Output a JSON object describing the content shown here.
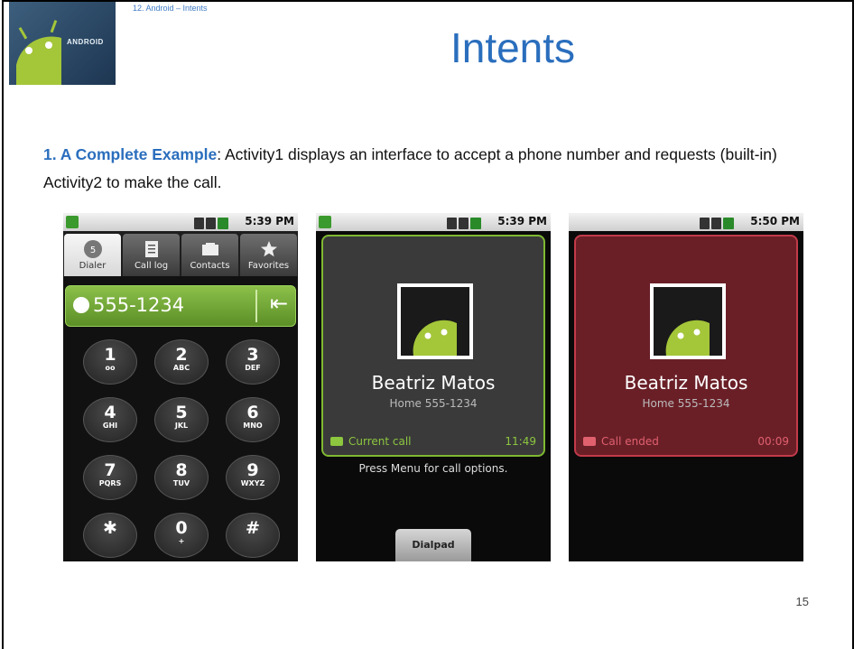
{
  "slide": {
    "breadcrumb": "12. Android – Intents",
    "title": "Intents",
    "logo_text": "ANDROID",
    "intro_lead": "1. A Complete Example",
    "intro_rest": ":  Activity1  displays an interface to accept a phone number and requests (built-in) Activity2 to make the call.",
    "page_number": "15"
  },
  "phone1": {
    "status_time": "5:39 PM",
    "tabs": [
      {
        "label": "Dialer",
        "icon": "dialer-icon"
      },
      {
        "label": "Call log",
        "icon": "call-log-icon"
      },
      {
        "label": "Contacts",
        "icon": "contacts-icon"
      },
      {
        "label": "Favorites",
        "icon": "star-icon"
      }
    ],
    "number": "555-1234",
    "keys": [
      {
        "d": "1",
        "l": "ᴏᴏ"
      },
      {
        "d": "2",
        "l": "ABC"
      },
      {
        "d": "3",
        "l": "DEF"
      },
      {
        "d": "4",
        "l": "GHI"
      },
      {
        "d": "5",
        "l": "JKL"
      },
      {
        "d": "6",
        "l": "MNO"
      },
      {
        "d": "7",
        "l": "PQRS"
      },
      {
        "d": "8",
        "l": "TUV"
      },
      {
        "d": "9",
        "l": "WXYZ"
      },
      {
        "d": "✱",
        "l": ""
      },
      {
        "d": "0",
        "l": "+"
      },
      {
        "d": "#",
        "l": ""
      }
    ]
  },
  "phone2": {
    "status_time": "5:39 PM",
    "name": "Beatriz Matos",
    "sub": "Home 555-1234",
    "status": "Current call",
    "timer": "11:49",
    "hint": "Press Menu for call options.",
    "dialpad": "Dialpad"
  },
  "phone3": {
    "status_time": "5:50 PM",
    "name": "Beatriz Matos",
    "sub": "Home 555-1234",
    "status": "Call ended",
    "timer": "00:09"
  },
  "colors": {
    "accent": "#2a6ebd",
    "call_green": "#8dc63f",
    "ended_red": "#e0606e"
  }
}
